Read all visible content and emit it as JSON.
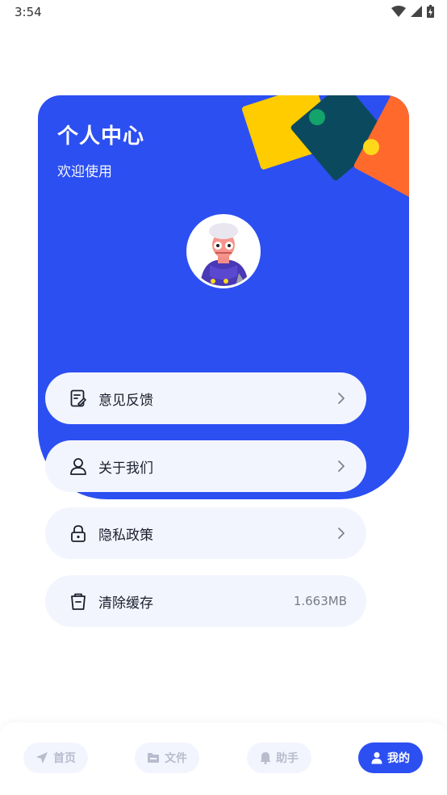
{
  "status": {
    "time": "3:54"
  },
  "header": {
    "title": "个人中心",
    "subtitle": "欢迎使用"
  },
  "menu": [
    {
      "label": "意见反馈",
      "icon": "feedback-icon"
    },
    {
      "label": "关于我们",
      "icon": "user-icon"
    },
    {
      "label": "隐私政策",
      "icon": "lock-icon"
    },
    {
      "label": "清除缓存",
      "icon": "trash-icon",
      "value": "1.663MB"
    }
  ],
  "nav": [
    {
      "label": "首页",
      "icon": "send-icon",
      "active": false
    },
    {
      "label": "文件",
      "icon": "folder-icon",
      "active": false
    },
    {
      "label": "助手",
      "icon": "bell-icon",
      "active": false
    },
    {
      "label": "我的",
      "icon": "person-icon",
      "active": true
    }
  ],
  "colors": {
    "primary": "#2c4ff2",
    "item_bg": "#f3f5fe",
    "decor_yellow": "#ffcc00",
    "decor_dark": "#0b4a5e",
    "decor_orange": "#ff6a2c",
    "decor_green": "#13a36b"
  }
}
